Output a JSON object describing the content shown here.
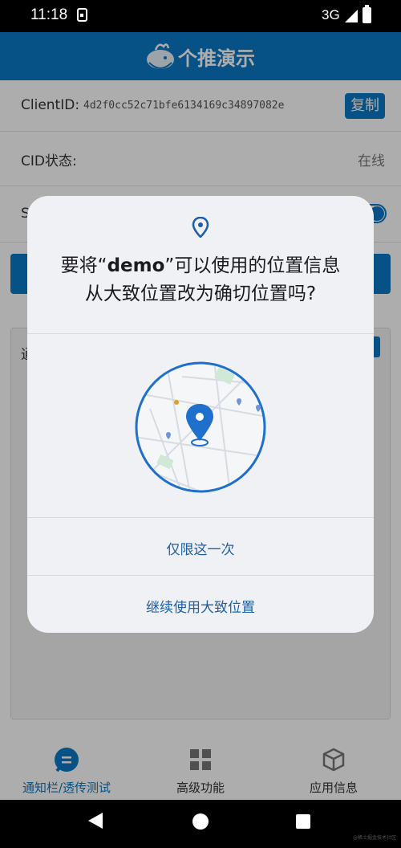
{
  "status_bar": {
    "time": "11:18",
    "network": "3G",
    "icons": [
      "sim-icon",
      "signal-icon",
      "battery-icon"
    ]
  },
  "app_bar": {
    "title": "个推演示",
    "logo": "whale-logo-icon",
    "color": "#0a78c4"
  },
  "info": {
    "client_id_label": "ClientID:",
    "client_id_value": "4d2f0cc52c71bfe6134169c34897082e",
    "copy_label": "复制",
    "cid_status_label": "CID状态:",
    "cid_status_value": "在线",
    "switch_row_label_partial": "S",
    "panel_label_partial": "通"
  },
  "dialog": {
    "title_prefix": "要将“",
    "app_name": "demo",
    "title_suffix": "”可以使用的位置信息",
    "title_line2": "从大致位置改为确切位置吗?",
    "option_once": "仅限这一次",
    "option_keep_approximate": "继续使用大致位置",
    "accent": "#1f5fa8"
  },
  "bottom_nav": {
    "items": [
      {
        "label": "通知栏/透传测试",
        "icon": "chat-icon",
        "active": true
      },
      {
        "label": "高级功能",
        "icon": "grid-icon",
        "active": false
      },
      {
        "label": "应用信息",
        "icon": "box-icon",
        "active": false
      }
    ]
  },
  "system_nav": {
    "watermark": "@稀土掘金技术社区"
  }
}
